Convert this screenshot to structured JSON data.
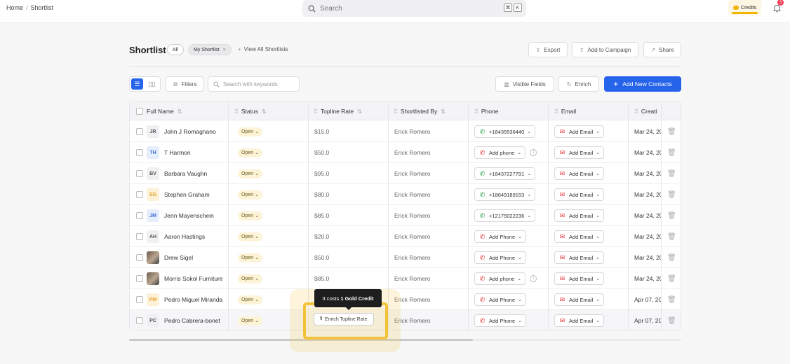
{
  "breadcrumb": [
    "Home",
    "Shortlist"
  ],
  "search": {
    "placeholder": "Search",
    "kbd": [
      "⌘",
      "K"
    ]
  },
  "credits": {
    "label": "Credits"
  },
  "notifications": {
    "count": "3"
  },
  "header": {
    "title": "Shortlist",
    "tabs": [
      "All",
      "My Shortlist"
    ],
    "view_all": "View All Shortlists",
    "export": "Export",
    "add_campaign": "Add to Campaign",
    "share": "Share"
  },
  "toolbar": {
    "filters": "Filters",
    "search_placeholder": "Search with keywords",
    "visible_fields": "Visible Fields",
    "enrich": "Enrich",
    "add_new": "Add New Contacts"
  },
  "columns": [
    "Full Name",
    "Status",
    "Topline Rate",
    "Shortlisted By",
    "Phone",
    "Email",
    "Creati"
  ],
  "rows": [
    {
      "initials": "JR",
      "name": "John J Romagnano",
      "status": "Open",
      "rate": "$15.0",
      "by": "Erick Romero",
      "phone": "+18435536440",
      "phone_ok": true,
      "info": false,
      "email": "Add Email",
      "created": "Mar 24, 20"
    },
    {
      "initials": "TH",
      "name": "T Harmon",
      "status": "Open",
      "rate": "$50.0",
      "by": "Erick Romero",
      "phone": "Add phone",
      "phone_ok": false,
      "info": true,
      "email": "Add Email",
      "created": "Mar 24, 20"
    },
    {
      "initials": "BV",
      "name": "Barbara Vaughn",
      "status": "Open",
      "rate": "$95.0",
      "by": "Erick Romero",
      "phone": "+18437227791",
      "phone_ok": true,
      "info": false,
      "email": "Add Email",
      "created": "Mar 24, 20"
    },
    {
      "initials": "SG",
      "name": "Stephen Graham",
      "status": "Open",
      "rate": "$80.0",
      "by": "Erick Romero",
      "phone": "+18649189153",
      "phone_ok": true,
      "info": false,
      "email": "Add Email",
      "created": "Mar 24, 20"
    },
    {
      "initials": "JM",
      "name": "Jenn Mayenschein",
      "status": "Open",
      "rate": "$85.0",
      "by": "Erick Romero",
      "phone": "+12175022236",
      "phone_ok": true,
      "info": false,
      "email": "Add Email",
      "created": "Mar 24, 20"
    },
    {
      "initials": "AH",
      "name": "Aaron Hastings",
      "status": "Open",
      "rate": "$20.0",
      "by": "Erick Romero",
      "phone": "Add Phone",
      "phone_ok": false,
      "info": false,
      "email": "Add Email",
      "created": "Mar 24, 20"
    },
    {
      "initials": "",
      "name": "Drew Sigel",
      "status": "Open",
      "rate": "$50.0",
      "by": "Erick Romero",
      "phone": "Add Phone",
      "phone_ok": false,
      "info": false,
      "email": "Add Email",
      "created": "Mar 24, 20"
    },
    {
      "initials": "",
      "name": "Morris Sokol Furniture",
      "status": "Open",
      "rate": "$85.0",
      "by": "Erick Romero",
      "phone": "Add phone",
      "phone_ok": false,
      "info": true,
      "email": "Add Email",
      "created": "Mar 24, 20"
    },
    {
      "initials": "PM",
      "name": "Pedro Miguel Miranda",
      "status": "Open",
      "rate": "",
      "by": "Erick Romero",
      "phone": "Add Phone",
      "phone_ok": false,
      "info": false,
      "email": "Add Email",
      "created": "Apr 07, 20"
    },
    {
      "initials": "PC",
      "name": "Pedro Cabrera-bonet",
      "status": "Open",
      "rate": "",
      "by": "Erick Romero",
      "phone": "Add Phone",
      "phone_ok": false,
      "info": false,
      "email": "Add Email",
      "created": "Apr 07, 20"
    }
  ],
  "enrich_button": "Enrich Topline Rate",
  "tooltip": {
    "prefix": "It costs",
    "amount": "1 Gold Credit"
  }
}
